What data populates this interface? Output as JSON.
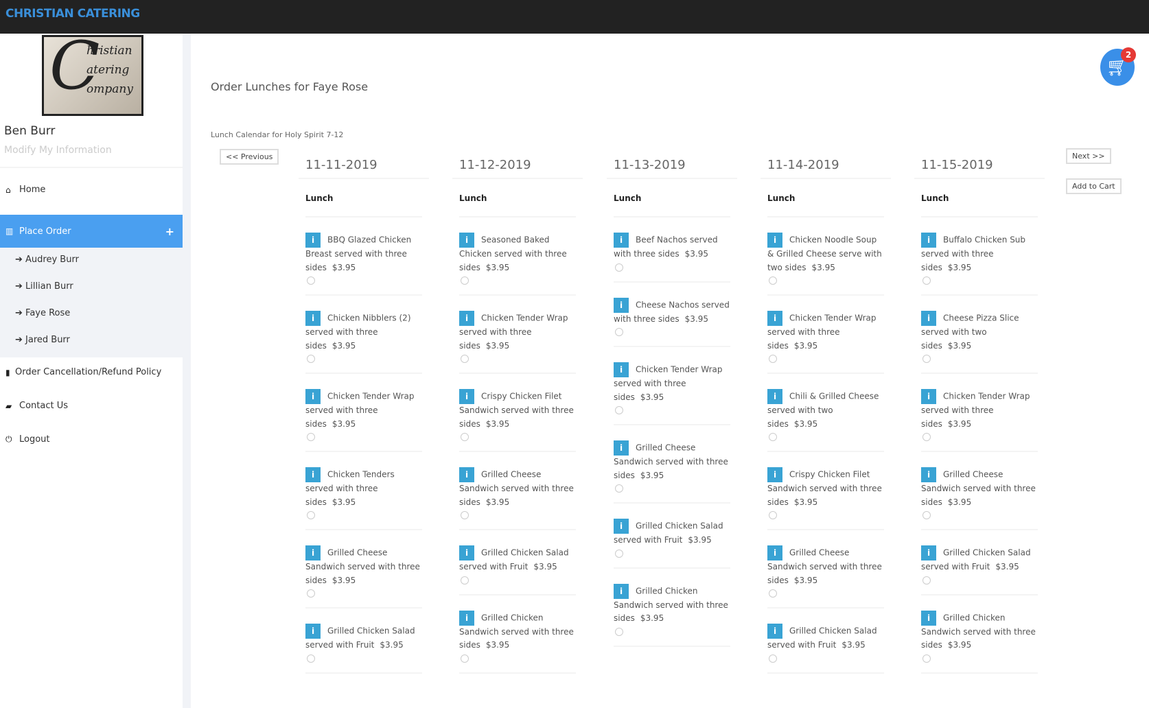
{
  "header": {
    "brand": "CHRISTIAN CATERING"
  },
  "sidebar": {
    "logo_text": [
      "Christian",
      "Catering",
      "Company"
    ],
    "user_name": "Ben Burr",
    "modify_link": "Modify My Information",
    "nav": {
      "home": "Home",
      "place_order": "Place Order",
      "policy": "Order Cancellation/Refund Policy",
      "contact": "Contact Us",
      "logout": "Logout"
    },
    "students": [
      "Audrey Burr",
      "Lillian Burr",
      "Faye Rose",
      "Jared Burr"
    ]
  },
  "main": {
    "title": "Order Lunches for Faye Rose",
    "calendar_title": "Lunch Calendar for Holy Spirit 7-12",
    "previous_label": "<< Previous",
    "next_label": "Next >>",
    "add_to_cart_label": "Add to Cart",
    "cart_count": "2",
    "meal_label": "Lunch",
    "days": [
      {
        "date": "11-11-2019",
        "items": [
          {
            "name": "BBQ Glazed Chicken Breast served with three sides",
            "price": "$3.95"
          },
          {
            "name": "Chicken Nibblers (2) served with three sides",
            "price": "$3.95"
          },
          {
            "name": "Chicken Tender Wrap served with three sides",
            "price": "$3.95"
          },
          {
            "name": "Chicken Tenders served with three sides",
            "price": "$3.95"
          },
          {
            "name": "Grilled Cheese Sandwich served with three sides",
            "price": "$3.95"
          },
          {
            "name": "Grilled Chicken Salad served with Fruit",
            "price": "$3.95"
          }
        ]
      },
      {
        "date": "11-12-2019",
        "items": [
          {
            "name": "Seasoned Baked Chicken served with three sides",
            "price": "$3.95"
          },
          {
            "name": "Chicken Tender Wrap served with three sides",
            "price": "$3.95"
          },
          {
            "name": "Crispy Chicken Filet Sandwich served with three sides",
            "price": "$3.95"
          },
          {
            "name": "Grilled Cheese Sandwich served with three sides",
            "price": "$3.95"
          },
          {
            "name": "Grilled Chicken Salad served with Fruit",
            "price": "$3.95"
          },
          {
            "name": "Grilled Chicken Sandwich served with three sides",
            "price": "$3.95"
          }
        ]
      },
      {
        "date": "11-13-2019",
        "items": [
          {
            "name": "Beef Nachos served with three sides",
            "price": "$3.95"
          },
          {
            "name": "Cheese Nachos served with three sides",
            "price": "$3.95"
          },
          {
            "name": "Chicken Tender Wrap served with three sides",
            "price": "$3.95"
          },
          {
            "name": "Grilled Cheese Sandwich served with three sides",
            "price": "$3.95"
          },
          {
            "name": "Grilled Chicken Salad served with Fruit",
            "price": "$3.95"
          },
          {
            "name": "Grilled Chicken Sandwich served with three sides",
            "price": "$3.95"
          }
        ]
      },
      {
        "date": "11-14-2019",
        "items": [
          {
            "name": "Chicken Noodle Soup & Grilled Cheese serve with two sides",
            "price": "$3.95"
          },
          {
            "name": "Chicken Tender Wrap served with three sides",
            "price": "$3.95"
          },
          {
            "name": "Chili & Grilled Cheese served with two sides",
            "price": "$3.95"
          },
          {
            "name": "Crispy Chicken Filet Sandwich served with three sides",
            "price": "$3.95"
          },
          {
            "name": "Grilled Cheese Sandwich served with three sides",
            "price": "$3.95"
          },
          {
            "name": "Grilled Chicken Salad served with Fruit",
            "price": "$3.95"
          }
        ]
      },
      {
        "date": "11-15-2019",
        "items": [
          {
            "name": "Buffalo Chicken Sub served with three sides",
            "price": "$3.95"
          },
          {
            "name": "Cheese Pizza Slice served with two sides",
            "price": "$3.95"
          },
          {
            "name": "Chicken Tender Wrap served with three sides",
            "price": "$3.95"
          },
          {
            "name": "Grilled Cheese Sandwich served with three sides",
            "price": "$3.95"
          },
          {
            "name": "Grilled Chicken Salad served with Fruit",
            "price": "$3.95"
          },
          {
            "name": "Grilled Chicken Sandwich served with three sides",
            "price": "$3.95"
          }
        ]
      }
    ]
  }
}
